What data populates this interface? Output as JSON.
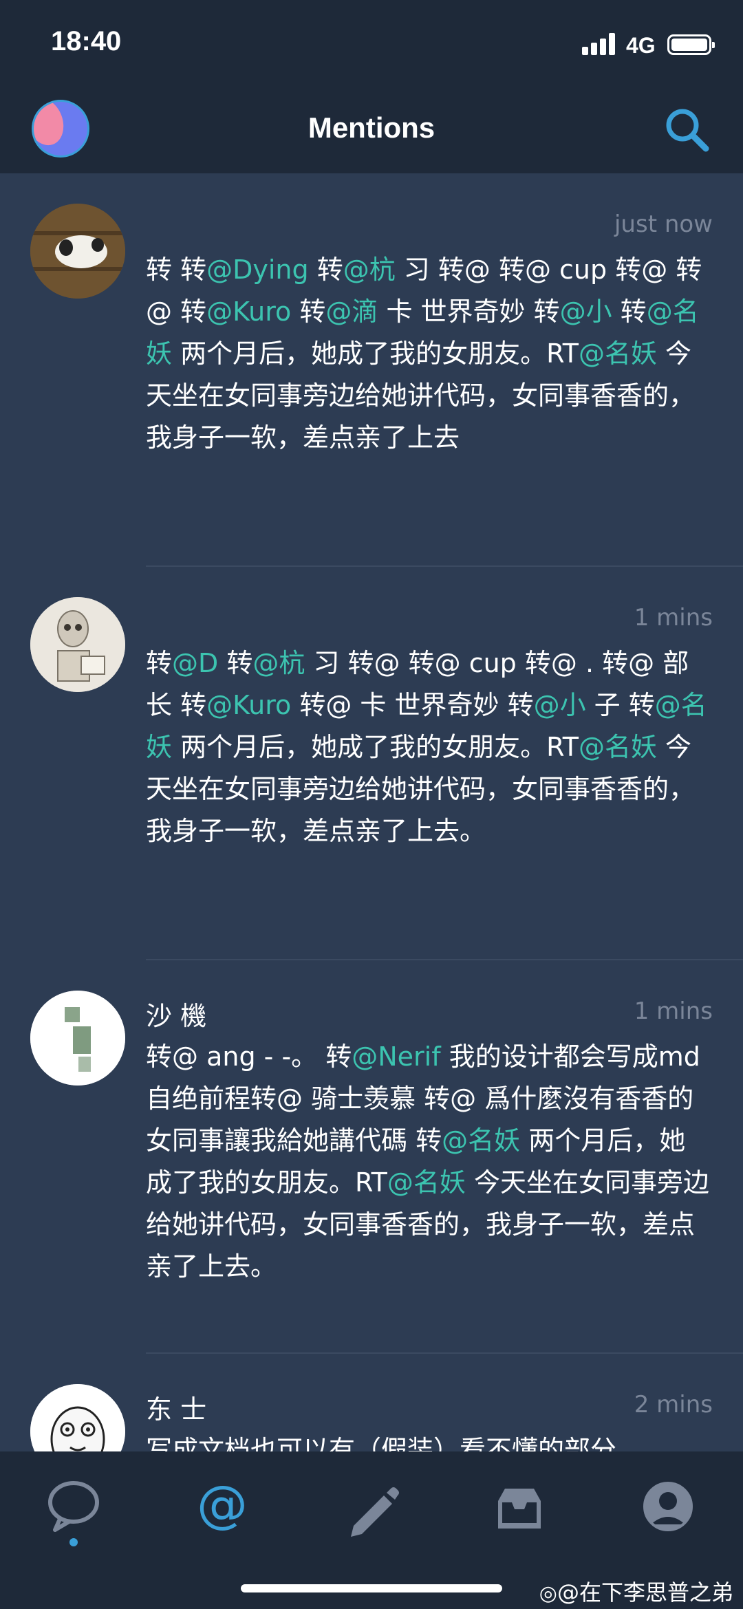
{
  "status_bar": {
    "time": "18:40",
    "network": "4G"
  },
  "nav": {
    "title": "Mentions"
  },
  "tweets": [
    {
      "name": "",
      "time": "just now",
      "body": "转        转@Dying 转@杭               习 转@                  转@                  cup 转@                转@               转@Kuro 转@滴      卡 世界奇妙 转@小       转@名妖 两个月后，她成了我的女朋友。RT@名妖 今天坐在女同事旁边给她讲代码，女同事香香的，我身子一软，差点亲了上去"
    },
    {
      "name": "",
      "time": "1 mins",
      "body": "转@D       转@杭          习 转@           转@              cup 转@         . 转@         部长 转@Kuro 转@           卡 世界奇妙 转@小             子 转@名妖 两个月后，她成了我的女朋友。RT@名妖 今天坐在女同事旁边给她讲代码，女同事香香的，我身子一软，差点亲了上去。"
    },
    {
      "name": "沙         機",
      "time": "1 mins",
      "body": "转@            ang - -。 转@Nerif 我的设计都会写成md    自绝前程转@            骑士羡慕 转@             爲什麼沒有香香的女同事讓我給她講代碼 转@名妖 两个月后，她成了我的女朋友。RT@名妖 今天坐在女同事旁边给她讲代码，女同事香香的，我身子一软，差点亲了上去。"
    },
    {
      "name": "东        士",
      "time": "2 mins",
      "body": "写成文档也可以有（假装）看不懂的部分"
    }
  ],
  "tabs": [
    {
      "icon": "speech-bubble-icon",
      "label": "Timeline"
    },
    {
      "icon": "at-sign-icon",
      "label": "Mentions",
      "active": true
    },
    {
      "icon": "pencil-icon",
      "label": "Compose"
    },
    {
      "icon": "inbox-icon",
      "label": "Messages"
    },
    {
      "icon": "profile-icon",
      "label": "Profile"
    }
  ],
  "watermark": "@在下李思普之弟",
  "colors": {
    "accent": "#3a9fd8",
    "mention": "#3cc4b0",
    "background": "#2d3c53",
    "bar": "#1e2939"
  }
}
